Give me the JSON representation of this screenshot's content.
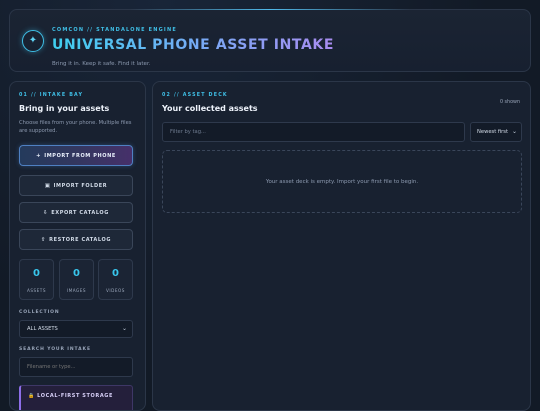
{
  "header": {
    "badge_icon": "✦",
    "eyebrow": "COMCON // STANDALONE ENGINE",
    "title": "UNIVERSAL PHONE ASSET INTAKE",
    "subtitle": "Bring it in. Keep it safe. Find it later."
  },
  "intake": {
    "eyebrow": "01 // INTAKE BAY",
    "title": "Bring in your assets",
    "description": "Choose files from your phone. Multiple files are supported.",
    "buttons": {
      "import_phone": {
        "icon": "+",
        "label": "IMPORT FROM PHONE"
      },
      "import_folder": {
        "icon": "▣",
        "label": "IMPORT FOLDER"
      },
      "export_catalog": {
        "icon": "⇩",
        "label": "EXPORT CATALOG"
      },
      "restore_catalog": {
        "icon": "⇧",
        "label": "RESTORE CATALOG"
      }
    },
    "stats": [
      {
        "value": "0",
        "label": "ASSETS"
      },
      {
        "value": "0",
        "label": "IMAGES"
      },
      {
        "value": "0",
        "label": "VIDEOS"
      }
    ],
    "collection_label": "COLLECTION",
    "collection_value": "ALL ASSETS",
    "search_label": "SEARCH YOUR INTAKE",
    "search_placeholder": "Filename or type...",
    "storage_icon": "🔒",
    "storage_label": "LOCAL-FIRST STORAGE"
  },
  "deck": {
    "eyebrow": "02 // ASSET DECK",
    "title": "Your collected assets",
    "shown": "0 shown",
    "filter_placeholder": "Filter by tag...",
    "sort_value": "Newest first",
    "empty_message": "Your asset deck is empty. Import your first file to begin."
  },
  "colors": {
    "accent": "#3fbfe6",
    "purple": "#8d6ee8",
    "background": "#121a26"
  }
}
